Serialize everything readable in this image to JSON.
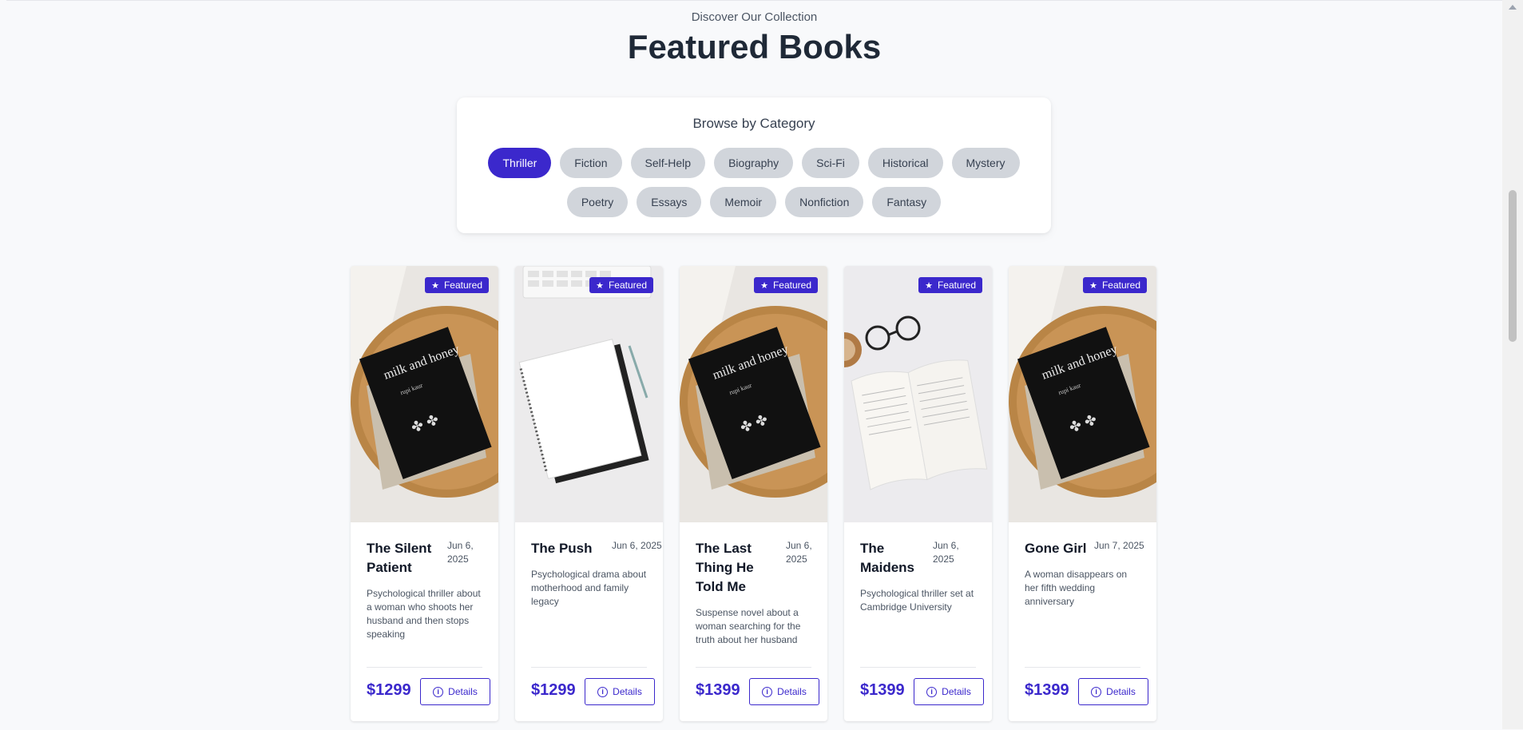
{
  "header": {
    "eyebrow": "Discover Our Collection",
    "title": "Featured Books"
  },
  "categories": {
    "title": "Browse by Category",
    "active": "Thriller",
    "row1": [
      "Thriller",
      "Fiction",
      "Self-Help",
      "Biography",
      "Sci-Fi",
      "Historical",
      "Mystery"
    ],
    "row2": [
      "Poetry",
      "Essays",
      "Memoir",
      "Nonfiction",
      "Fantasy"
    ]
  },
  "badge_label": "Featured",
  "details_label": "Details",
  "books": [
    {
      "title": "The Silent Patient",
      "date": "Jun 6, 2025",
      "description": "Psychological thriller about a woman who shoots her husband and then stops speaking",
      "price": "$1299",
      "image": "book-on-table"
    },
    {
      "title": "The Push",
      "date": "Jun 6, 2025",
      "description": "Psychological drama about motherhood and family legacy",
      "price": "$1299",
      "image": "notebook-desk"
    },
    {
      "title": "The Last Thing He Told Me",
      "date": "Jun 6, 2025",
      "description": "Suspense novel about a woman searching for the truth about her husband",
      "price": "$1399",
      "image": "book-on-table"
    },
    {
      "title": "The Maidens",
      "date": "Jun 6, 2025",
      "description": "Psychological thriller set at Cambridge University",
      "price": "$1399",
      "image": "open-book-glasses"
    },
    {
      "title": "Gone Girl",
      "date": "Jun 7, 2025",
      "description": "A woman disappears on her fifth wedding anniversary",
      "price": "$1399",
      "image": "book-on-table"
    }
  ],
  "photo_text": {
    "book_title": "milk and honey",
    "book_author": "rupi kaur"
  },
  "colors": {
    "accent": "#3b28cc",
    "chip_inactive": "#d1d5db",
    "background": "#f8f9fb"
  }
}
